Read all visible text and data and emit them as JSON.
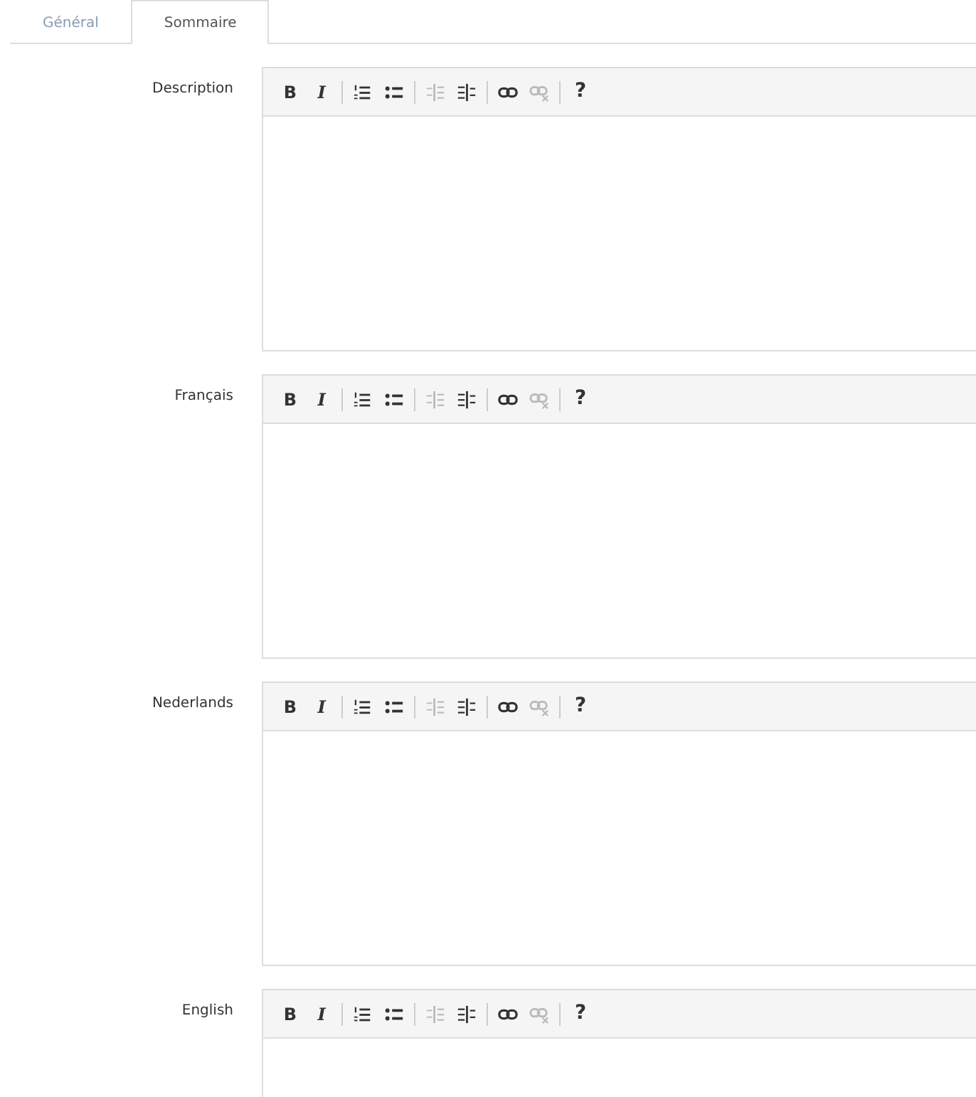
{
  "tabs": [
    {
      "label": "Général",
      "selected": false
    },
    {
      "label": "Sommaire",
      "selected": true
    }
  ],
  "editors": [
    {
      "label": "Description",
      "toolbar": [
        [
          {
            "kind": "bold",
            "text": "B",
            "disabled": false
          },
          {
            "kind": "italic",
            "text": "I",
            "disabled": false
          }
        ],
        [
          {
            "kind": "ordered-list",
            "disabled": false
          },
          {
            "kind": "bullet-list",
            "disabled": false
          }
        ],
        [
          {
            "kind": "outdent",
            "disabled": true
          },
          {
            "kind": "indent",
            "disabled": false
          }
        ],
        [
          {
            "kind": "link",
            "disabled": false
          },
          {
            "kind": "unlink",
            "disabled": true
          }
        ],
        [
          {
            "kind": "help",
            "text": "?",
            "disabled": false
          }
        ]
      ]
    },
    {
      "label": "Français",
      "toolbar": [
        [
          {
            "kind": "bold",
            "text": "B",
            "disabled": false
          },
          {
            "kind": "italic",
            "text": "I",
            "disabled": false
          }
        ],
        [
          {
            "kind": "ordered-list",
            "disabled": false
          },
          {
            "kind": "bullet-list",
            "disabled": false
          }
        ],
        [
          {
            "kind": "outdent",
            "disabled": true
          },
          {
            "kind": "indent",
            "disabled": false
          }
        ],
        [
          {
            "kind": "link",
            "disabled": false
          },
          {
            "kind": "unlink",
            "disabled": true
          }
        ],
        [
          {
            "kind": "help",
            "text": "?",
            "disabled": false
          }
        ]
      ]
    },
    {
      "label": "Nederlands",
      "toolbar": [
        [
          {
            "kind": "bold",
            "text": "B",
            "disabled": false
          },
          {
            "kind": "italic",
            "text": "I",
            "disabled": false
          }
        ],
        [
          {
            "kind": "ordered-list",
            "disabled": false
          },
          {
            "kind": "bullet-list",
            "disabled": false
          }
        ],
        [
          {
            "kind": "outdent",
            "disabled": true
          },
          {
            "kind": "indent",
            "disabled": false
          }
        ],
        [
          {
            "kind": "link",
            "disabled": false
          },
          {
            "kind": "unlink",
            "disabled": true
          }
        ],
        [
          {
            "kind": "help",
            "text": "?",
            "disabled": false
          }
        ]
      ]
    },
    {
      "label": "English",
      "toolbar": [
        [
          {
            "kind": "bold",
            "text": "B",
            "disabled": false
          },
          {
            "kind": "italic",
            "text": "I",
            "disabled": false
          }
        ],
        [
          {
            "kind": "ordered-list",
            "disabled": false
          },
          {
            "kind": "bullet-list",
            "disabled": false
          }
        ],
        [
          {
            "kind": "outdent",
            "disabled": true
          },
          {
            "kind": "indent",
            "disabled": false
          }
        ],
        [
          {
            "kind": "link",
            "disabled": false
          },
          {
            "kind": "unlink",
            "disabled": true
          }
        ],
        [
          {
            "kind": "help",
            "text": "?",
            "disabled": false
          }
        ]
      ]
    }
  ]
}
